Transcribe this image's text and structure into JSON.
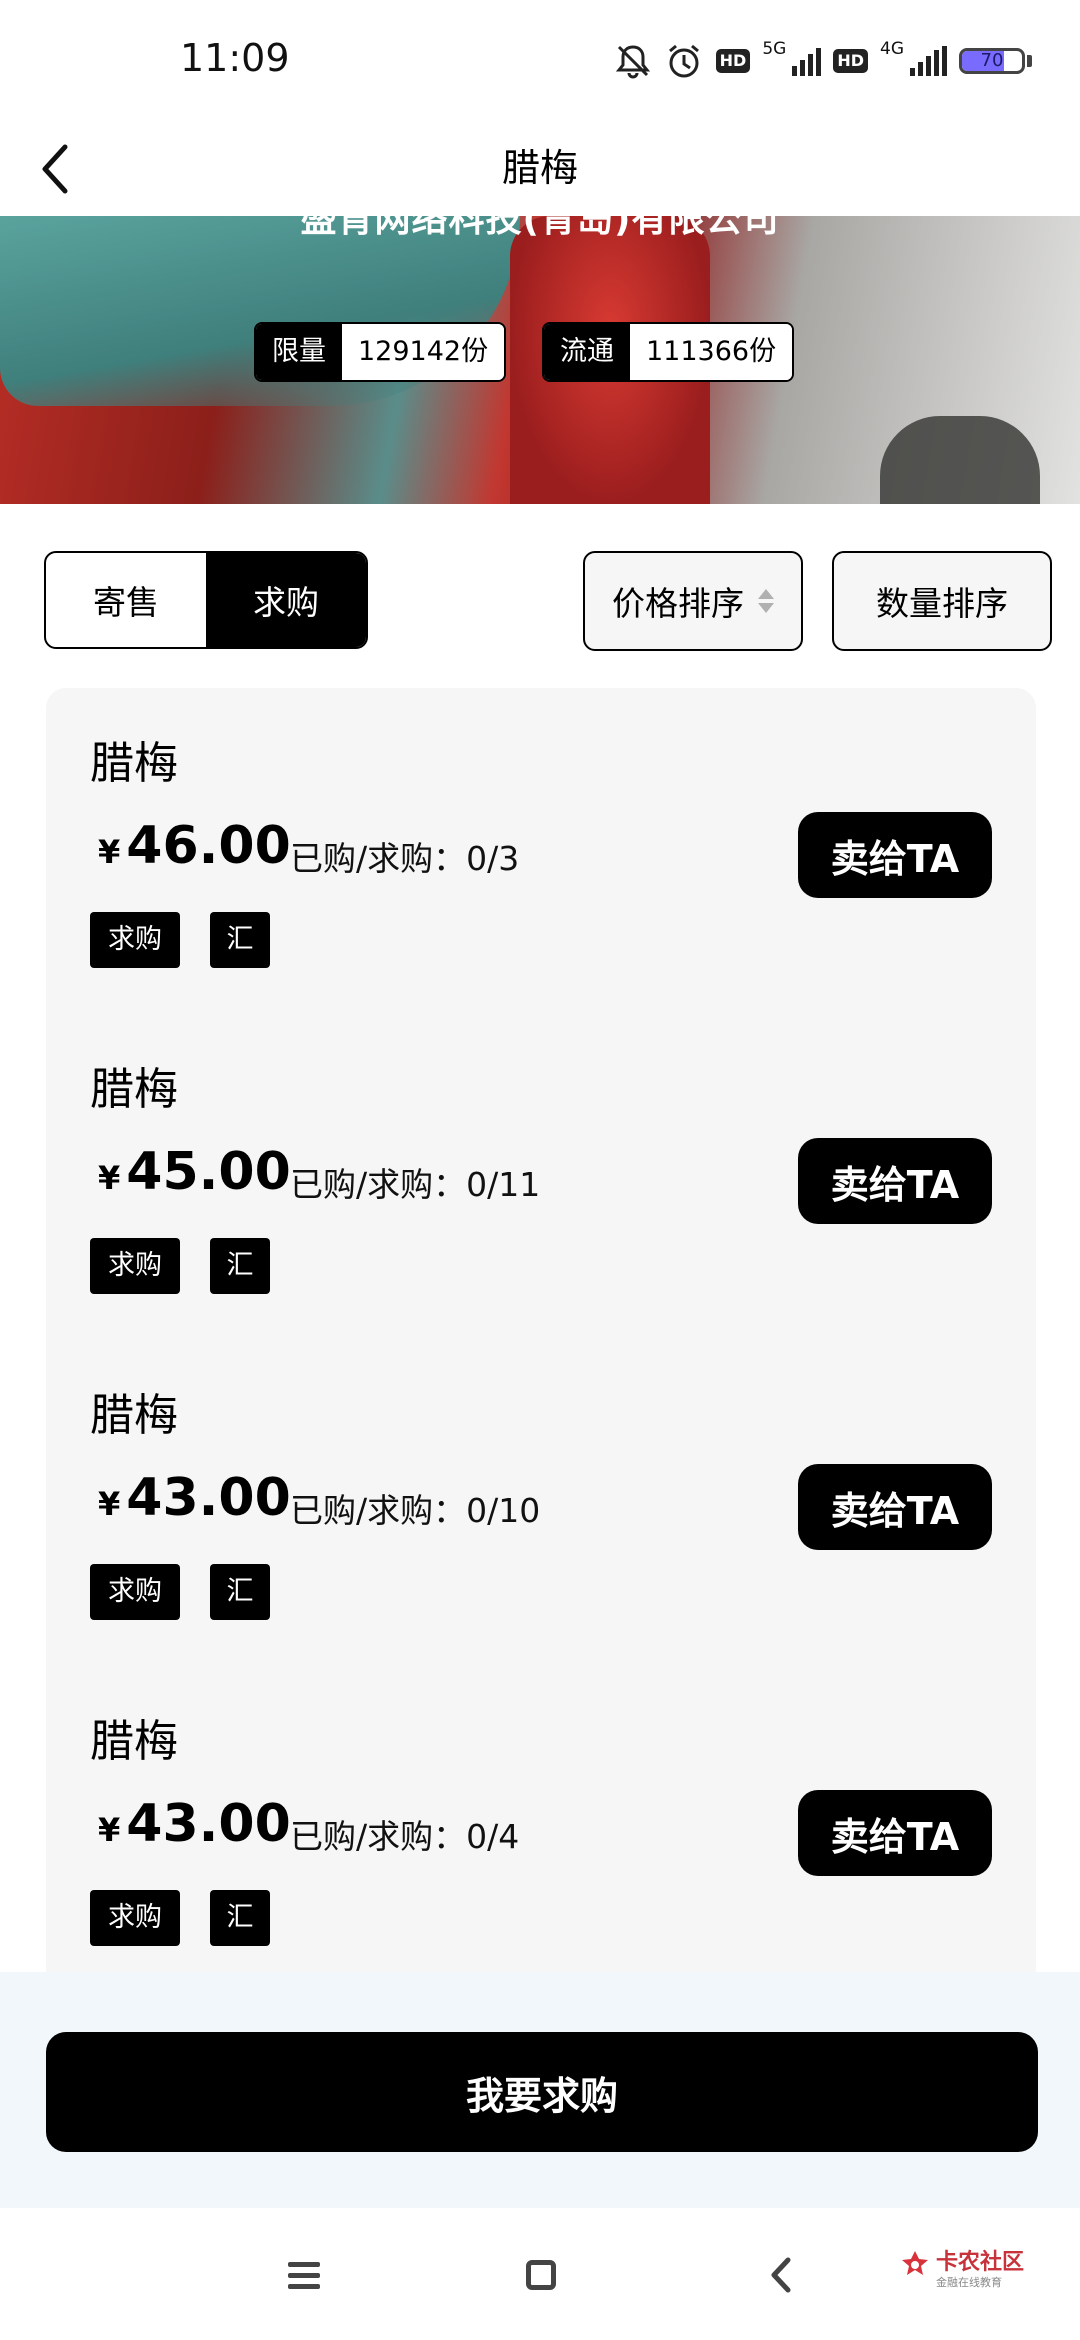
{
  "status_bar": {
    "time": "11:09",
    "net_5g": "5G",
    "net_4g": "4G",
    "hd": "HD",
    "battery": "70",
    "battery_level_percent": 70
  },
  "nav": {
    "title": "腊梅"
  },
  "hero": {
    "company": "盛肯网络科技(青岛)有限公司",
    "limit_label": "限量",
    "limit_value": "129142份",
    "circulation_label": "流通",
    "circulation_value": "111366份"
  },
  "tabs": {
    "consign": "寄售",
    "buy_request": "求购",
    "active": "求购"
  },
  "sort": {
    "price": "价格排序",
    "quantity": "数量排序"
  },
  "items": [
    {
      "name": "腊梅",
      "currency": "¥",
      "price": "46.00",
      "bought": "已购/求购：0/3",
      "tag1": "求购",
      "tag2": "汇",
      "action": "卖给TA"
    },
    {
      "name": "腊梅",
      "currency": "¥",
      "price": "45.00",
      "bought": "已购/求购：0/11",
      "tag1": "求购",
      "tag2": "汇",
      "action": "卖给TA"
    },
    {
      "name": "腊梅",
      "currency": "¥",
      "price": "43.00",
      "bought": "已购/求购：0/10",
      "tag1": "求购",
      "tag2": "汇",
      "action": "卖给TA"
    },
    {
      "name": "腊梅",
      "currency": "¥",
      "price": "43.00",
      "bought": "已购/求购：0/4",
      "tag1": "求购",
      "tag2": "汇",
      "action": "卖给TA"
    }
  ],
  "footer": {
    "want_buy": "我要求购"
  },
  "watermark": {
    "text": "卡农社区",
    "sub": "金融在线教育"
  }
}
